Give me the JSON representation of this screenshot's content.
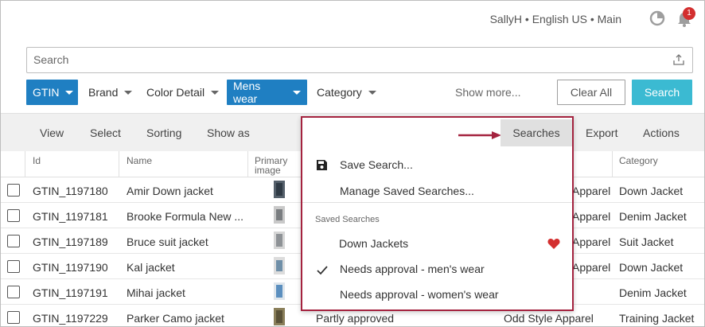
{
  "header": {
    "user": "SallyH • English US • Main",
    "notification_count": "1"
  },
  "search": {
    "placeholder": "Search"
  },
  "filters": [
    {
      "label": "GTIN",
      "active": true
    },
    {
      "label": "Brand",
      "active": false
    },
    {
      "label": "Color Detail",
      "active": false
    },
    {
      "label": "Mens wear",
      "active": true
    },
    {
      "label": "Category",
      "active": false
    }
  ],
  "filter_actions": {
    "show_more": "Show more...",
    "clear_all": "Clear All",
    "search": "Search"
  },
  "toolbar": {
    "view": "View",
    "select": "Select",
    "sorting": "Sorting",
    "show_as": "Show as",
    "export": "Export",
    "actions": "Actions"
  },
  "table": {
    "columns": [
      "Id",
      "Name",
      "Primary image",
      "Category"
    ],
    "rows": [
      {
        "id": "GTIN_1197180",
        "name": "Amir Down jacket",
        "brand": "Apparel",
        "category": "Down Jacket"
      },
      {
        "id": "GTIN_1197181",
        "name": "Brooke Formula New ...",
        "brand": "Apparel",
        "category": "Denim Jacket"
      },
      {
        "id": "GTIN_1197189",
        "name": "Bruce suit jacket",
        "brand": "Apparel",
        "category": "Suit Jacket"
      },
      {
        "id": "GTIN_1197190",
        "name": "Kal jacket",
        "brand": "Apparel",
        "category": "Down Jacket"
      },
      {
        "id": "GTIN_1197191",
        "name": "Mihai jacket",
        "brand": "",
        "category": "Denim Jacket"
      },
      {
        "id": "GTIN_1197229",
        "name": "Parker Camo jacket",
        "status": "Partly approved",
        "brand": "Odd Style Apparel",
        "category": "Training Jacket"
      }
    ]
  },
  "searches_menu": {
    "trigger": "Searches",
    "save": "Save Search...",
    "manage": "Manage Saved Searches...",
    "section": "Saved Searches",
    "saved": [
      {
        "label": "Down Jackets",
        "favorite": true,
        "checked": false
      },
      {
        "label": "Needs approval - men's wear",
        "favorite": false,
        "checked": true
      },
      {
        "label": "Needs approval - women's wear",
        "favorite": false,
        "checked": false
      }
    ]
  },
  "colors": {
    "primary_blue": "#1f7fc2",
    "search_teal": "#3bbad2",
    "highlight_red": "#a4233f",
    "badge_red": "#d32f2f"
  }
}
